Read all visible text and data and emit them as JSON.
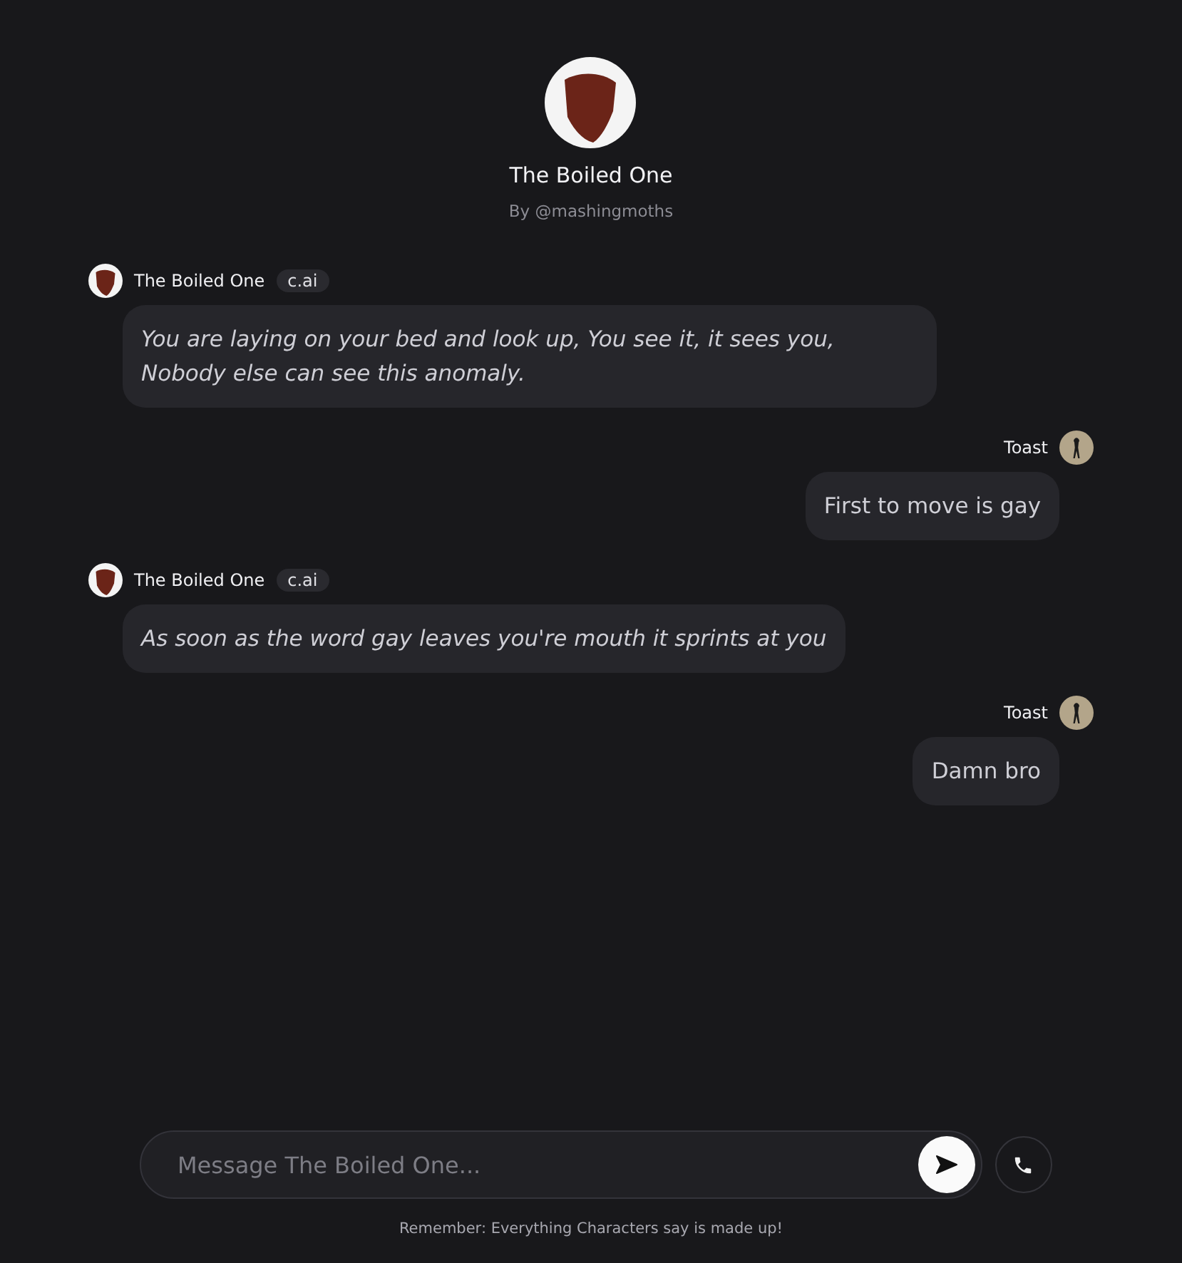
{
  "character": {
    "name": "The Boiled One",
    "creator": "By @mashingmoths"
  },
  "messages": [
    {
      "kind": "character",
      "author": "The Boiled One",
      "badge": "c.ai",
      "text": "You are laying on your bed and look up, You see it, it sees you, Nobody else can see this anomaly."
    },
    {
      "kind": "user",
      "author": "Toast",
      "text": "First to move is gay"
    },
    {
      "kind": "character",
      "author": "The Boiled One",
      "badge": "c.ai",
      "text": "As soon as the word gay leaves you're mouth it sprints at you"
    },
    {
      "kind": "user",
      "author": "Toast",
      "text": "Damn bro"
    }
  ],
  "composer": {
    "placeholder": "Message The Boiled One..."
  },
  "disclaimer": "Remember: Everything Characters say is made up!"
}
